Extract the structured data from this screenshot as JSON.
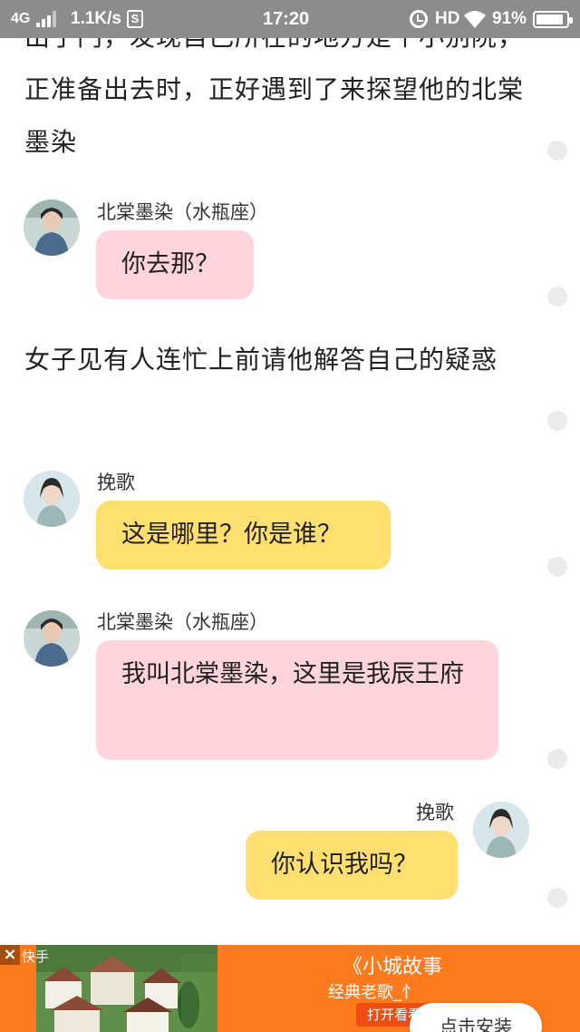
{
  "status_bar": {
    "network": "4G",
    "speed": "1.1K/s",
    "s_icon_label": "S",
    "time": "17:20",
    "hd": "HD",
    "battery_percent_text": "91%",
    "battery_level": 0.91
  },
  "story": {
    "paragraphs": [
      "出了门，发现自己所在的地方是个小别院，正准备出去时，正好遇到了来探望他的北棠墨染",
      "女子见有人连忙上前请他解答自己的疑惑"
    ]
  },
  "messages": [
    {
      "speaker": "北棠墨染（水瓶座）",
      "text": "你去那？",
      "bubble_color": "#ffd4dd",
      "side": "left"
    },
    {
      "speaker": "挽歌",
      "text": "这是哪里？你是谁？",
      "bubble_color": "#ffdf70",
      "side": "left"
    },
    {
      "speaker": "北棠墨染（水瓶座）",
      "text": "我叫北棠墨染，这里是我辰王府",
      "bubble_color": "#ffd4dd",
      "side": "left"
    },
    {
      "speaker": "挽歌",
      "text": "你认识我吗？",
      "bubble_color": "#ffdf70",
      "side": "right"
    }
  ],
  "ad": {
    "close_icon": "close-icon",
    "source": "快手",
    "title": "《小城故事",
    "subtitle": "经典老歌_忄",
    "open_label": "打开看看",
    "install_label": "点击安装",
    "background_color": "#ff7a1c"
  }
}
